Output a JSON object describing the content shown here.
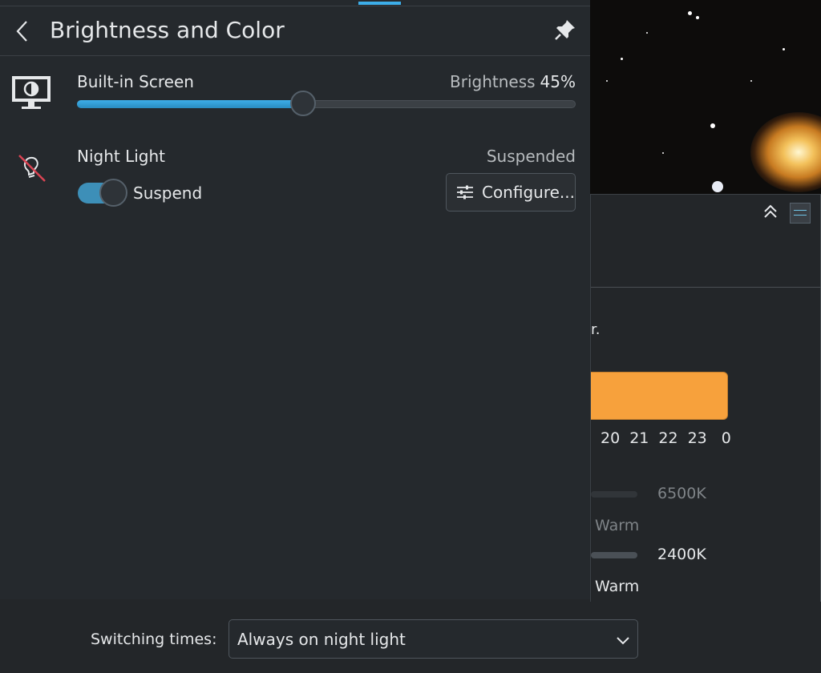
{
  "panel": {
    "title": "Brightness and Color",
    "back_icon": "chevron-left-icon",
    "pin_icon": "pin-icon"
  },
  "screen": {
    "label": "Built-in Screen",
    "brightness_label": "Brightness",
    "brightness_value": "45%",
    "brightness_fraction": 0.45,
    "icon": "monitor-icon"
  },
  "night_light": {
    "label": "Night Light",
    "status": "Suspended",
    "toggle_label": "Suspend",
    "toggle_on": true,
    "configure_label": "Configure...",
    "icon": "night-light-disabled-icon"
  },
  "background_window": {
    "text_fragment": "r.",
    "hours": [
      "20",
      "21",
      "22",
      "23",
      "0"
    ],
    "day_temp": "6500K",
    "night_temp": "2400K",
    "warm_label_1": "Warm",
    "warm_label_2": "Warm"
  },
  "switching": {
    "label": "Switching times:",
    "selected": "Always on night light"
  },
  "colors": {
    "accent": "#3daee9",
    "background": "#232629",
    "schedule_bar": "#f7a13c"
  }
}
